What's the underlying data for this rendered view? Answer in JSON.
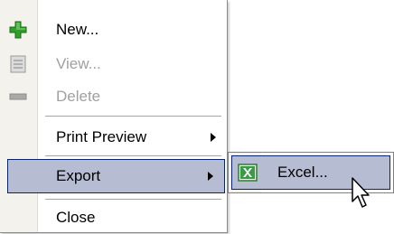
{
  "menu": {
    "items": [
      {
        "label": "New...",
        "icon": "plus-icon",
        "enabled": true
      },
      {
        "label": "View...",
        "icon": "view-icon",
        "enabled": false
      },
      {
        "label": "Delete",
        "icon": "minus-icon",
        "enabled": false
      },
      {
        "label": "Print Preview",
        "has_submenu": true,
        "enabled": true
      },
      {
        "label": "Export",
        "has_submenu": true,
        "enabled": true,
        "highlighted": true
      },
      {
        "label": "Close",
        "enabled": true
      }
    ]
  },
  "submenu": {
    "items": [
      {
        "label": "Excel...",
        "icon": "excel-icon",
        "highlighted": true
      }
    ]
  },
  "colors": {
    "highlight_fill": "#b6bdd2",
    "highlight_border": "#0a246a",
    "gutter": "#f3f2ec",
    "plus_green": "#2f9e2a",
    "disabled_text": "#a0a0a0"
  }
}
